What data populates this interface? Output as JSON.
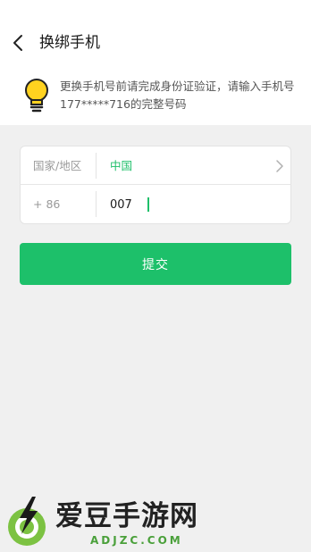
{
  "header": {
    "title": "换绑手机"
  },
  "notice": {
    "icon": "lightbulb-icon",
    "text": "更换手机号前请完成身份证验证，请输入手机号177*****716的完整号码"
  },
  "form": {
    "country_label": "国家/地区",
    "country_value": "中国",
    "dial_code": "+ 86",
    "phone_value": "007"
  },
  "actions": {
    "submit_label": "提交"
  },
  "watermark": {
    "name": "爱豆手游网",
    "domain": "ADJZC.COM"
  },
  "colors": {
    "accent": "#1dc06a",
    "background": "#f0f0f0"
  }
}
